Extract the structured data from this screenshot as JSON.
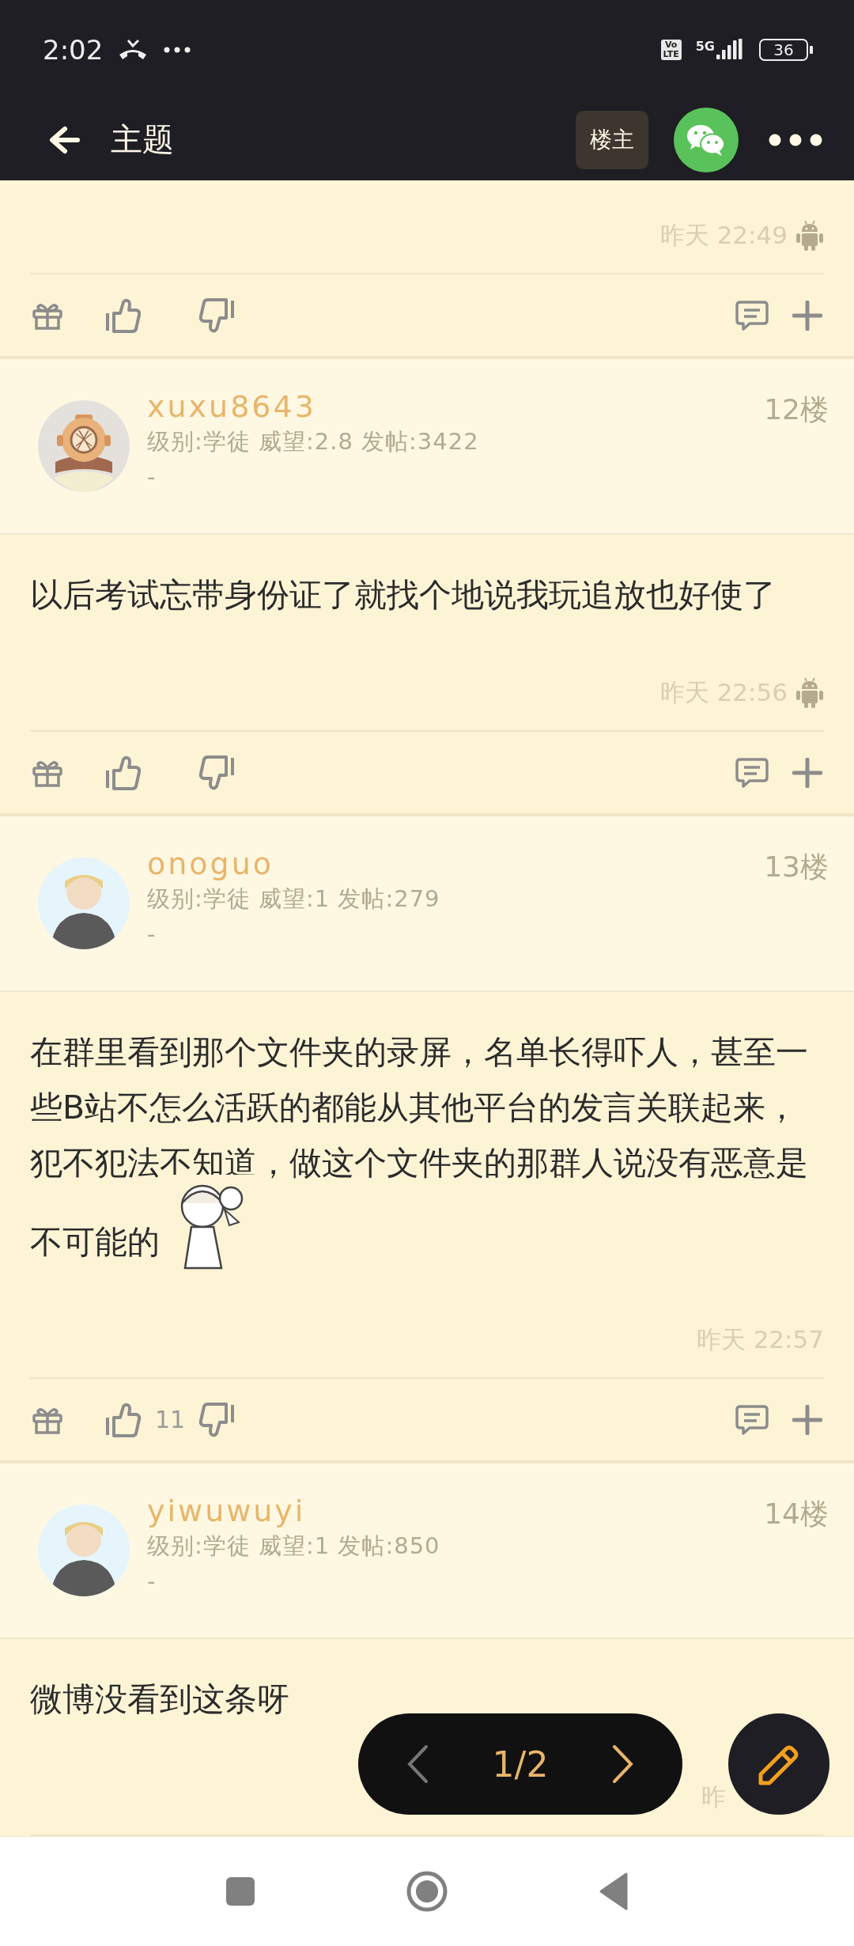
{
  "status_bar": {
    "time": "2:02",
    "volte_top": "Vo",
    "volte_bottom": "LTE",
    "network": "5G",
    "battery": "36"
  },
  "header": {
    "title": "主题",
    "author_button": "楼主"
  },
  "posts": [
    {
      "timestamp": "昨天 22:49",
      "android_icon": true,
      "has_action_bar": true
    },
    {
      "username": "xuxu8643",
      "meta": "级别:学徒 威望:2.8 发帖:3422",
      "signature": "-",
      "floor": "12楼",
      "avatar": {
        "kind": "helmet"
      },
      "body_lines": [
        "以后考试忘带身份证了就找个地说我玩追放也好使了"
      ],
      "timestamp": "昨天 22:56",
      "android_icon": true,
      "has_action_bar": true
    },
    {
      "username": "onoguo",
      "meta": "级别:学徒 威望:1 发帖:279",
      "signature": "-",
      "floor": "13楼",
      "avatar": {
        "kind": "figure"
      },
      "body_lines": [
        "在群里看到那个文件夹的录屏，名单长得吓人，甚至一",
        "些B站不怎么活跃的都能从其他平台的发言关联起来，",
        "犯不犯法不知道，做这个文件夹的那群人说没有恶意是",
        "不可能的"
      ],
      "timestamp": "昨天 22:57",
      "android_icon": false,
      "like_count": "11",
      "has_action_bar": true
    },
    {
      "username": "yiwuwuyi",
      "meta": "级别:学徒 威望:1 发帖:850",
      "signature": "-",
      "floor": "14楼",
      "avatar": {
        "kind": "figure"
      },
      "body_lines": [
        "微博没看到这条呀"
      ],
      "timestamp": "昨",
      "obscured": true,
      "has_action_bar": false
    }
  ],
  "pager": {
    "page": "1/2",
    "prev_disabled": true,
    "next_disabled": false
  }
}
